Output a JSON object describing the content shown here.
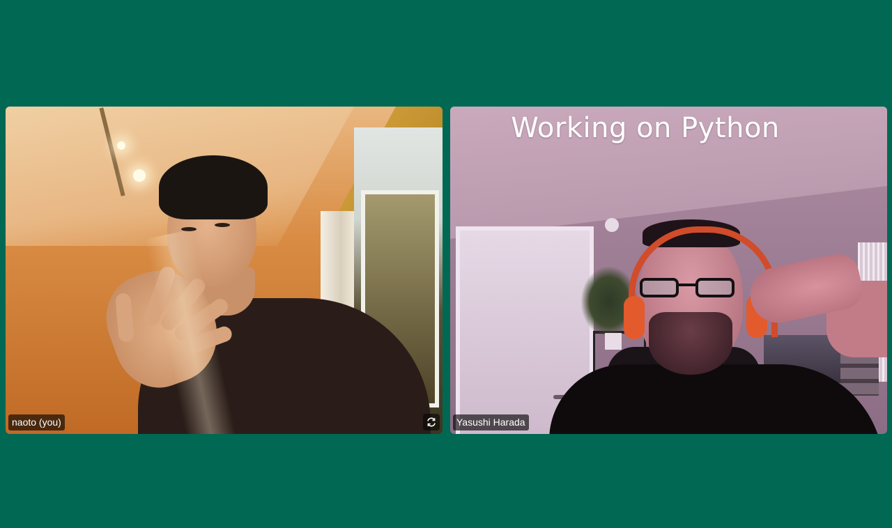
{
  "participants": [
    {
      "name": "naoto (you)",
      "controls": {
        "icon": "camera-switch-icon"
      }
    },
    {
      "name": "Yasushi Harada",
      "overlay_text": "Working on Python"
    }
  ],
  "colors": {
    "background": "#006853",
    "badge_bg": "rgba(0,0,0,0.62)",
    "badge_text": "#ffffff"
  }
}
